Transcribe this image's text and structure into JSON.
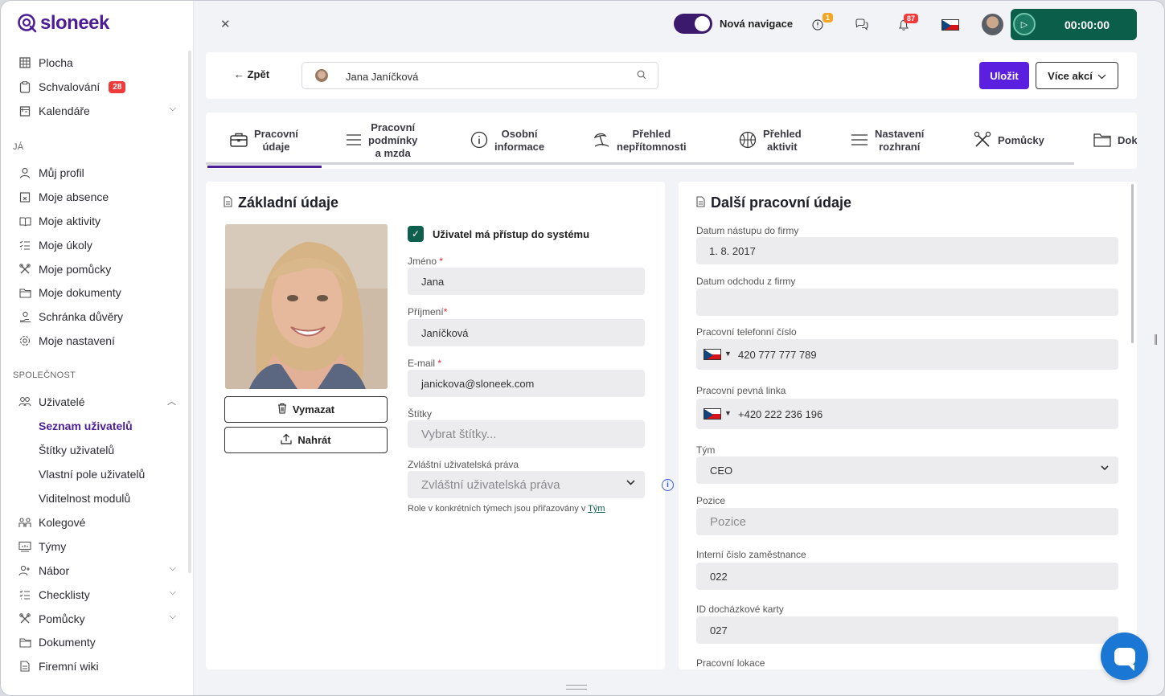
{
  "app": {
    "name": "sloneek"
  },
  "sidebar": {
    "top": [
      {
        "label": "Plocha",
        "icon": "grid-icon"
      },
      {
        "label": "Schvalování",
        "icon": "clipboard-icon",
        "badge": "28"
      },
      {
        "label": "Kalendáře",
        "icon": "calendar-icon"
      }
    ],
    "section_me": "JÁ",
    "me": [
      {
        "label": "Můj profil"
      },
      {
        "label": "Moje absence"
      },
      {
        "label": "Moje aktivity"
      },
      {
        "label": "Moje úkoly"
      },
      {
        "label": "Moje pomůcky"
      },
      {
        "label": "Moje dokumenty"
      },
      {
        "label": "Schránka důvěry"
      },
      {
        "label": "Moje nastavení"
      }
    ],
    "section_company": "SPOLEČNOST",
    "users": {
      "label": "Uživatelé"
    },
    "users_sub": [
      {
        "label": "Seznam uživatelů"
      },
      {
        "label": "Štítky uživatelů"
      },
      {
        "label": "Vlastní pole uživatelů"
      },
      {
        "label": "Viditelnost modulů"
      }
    ],
    "company": [
      {
        "label": "Kolegové"
      },
      {
        "label": "Týmy"
      },
      {
        "label": "Nábor"
      },
      {
        "label": "Checklisty"
      },
      {
        "label": "Pomůcky"
      },
      {
        "label": "Dokumenty"
      },
      {
        "label": "Firemní wiki"
      }
    ]
  },
  "topbar": {
    "toggle_label": "Nová navigace",
    "alert_badge": "1",
    "notif_badge": "87",
    "timer": "00:00:00",
    "colors": {
      "accent": "#3b1a6e",
      "timer": "#0b5e4a",
      "notif": "#ef3b3b",
      "alert": "#f5a623"
    }
  },
  "header": {
    "back": "← Zpět",
    "search_value": "Jana Janíčková",
    "save": "Uložit",
    "more": "Více akcí"
  },
  "tabs": [
    {
      "label": "Pracovní\núdaje"
    },
    {
      "label": "Pracovní\npodmínky\na mzda"
    },
    {
      "label": "Osobní\ninformace"
    },
    {
      "label": "Přehled\nnepřítomnosti"
    },
    {
      "label": "Přehled\naktivit"
    },
    {
      "label": "Nastavení\nrozhraní"
    },
    {
      "label": "Pomůcky"
    },
    {
      "label": "Dok"
    }
  ],
  "basic": {
    "title": "Základní údaje",
    "delete": "Vymazat",
    "upload": "Nahrát",
    "access": "Uživatel má přístup do systému",
    "first_name_label": "Jméno",
    "first_name": "Jana",
    "last_name_label": "Příjmení",
    "last_name": "Janíčková",
    "email_label": "E-mail",
    "email": "janickova@sloneek.com",
    "tags_label": "Štítky",
    "tags_placeholder": "Vybrat štítky...",
    "rights_label": "Zvláštní uživatelská práva",
    "rights_placeholder": "Zvláštní uživatelská práva",
    "note": "Role v konkrétních týmech jsou přiřazovány v",
    "note_link": "Tým"
  },
  "work": {
    "title": "Další pracovní údaje",
    "start_label": "Datum nástupu do firmy",
    "start": "1. 8. 2017",
    "end_label": "Datum odchodu z firmy",
    "end": "",
    "phone_label": "Pracovní telefonní číslo",
    "phone": "420 777 777 789",
    "landline_label": "Pracovní pevná linka",
    "landline": "+420 222 236 196",
    "team_label": "Tým",
    "team": "CEO",
    "position_label": "Pozice",
    "position_placeholder": "Pozice",
    "internal_label": "Interní číslo zaměstnance",
    "internal": "022",
    "card_label": "ID docházkové karty",
    "card": "027",
    "location_label": "Pracovní lokace"
  }
}
